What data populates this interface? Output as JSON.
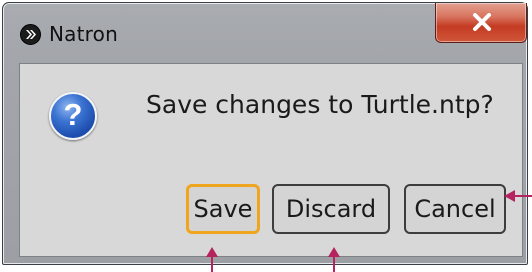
{
  "window": {
    "title": "Natron",
    "app_icon": "natron-logo-icon",
    "close_icon": "close-icon"
  },
  "dialog": {
    "icon": "question-icon",
    "icon_glyph": "?",
    "message": "Save changes to Turtle.ntp?",
    "buttons": {
      "save": "Save",
      "discard": "Discard",
      "cancel": "Cancel"
    },
    "default_button": "save"
  },
  "colors": {
    "focus_ring": "#f0a51e",
    "annotation_arrow": "#b5245e",
    "close_button": "#c43b22",
    "question_icon": "#1e4fb0"
  }
}
